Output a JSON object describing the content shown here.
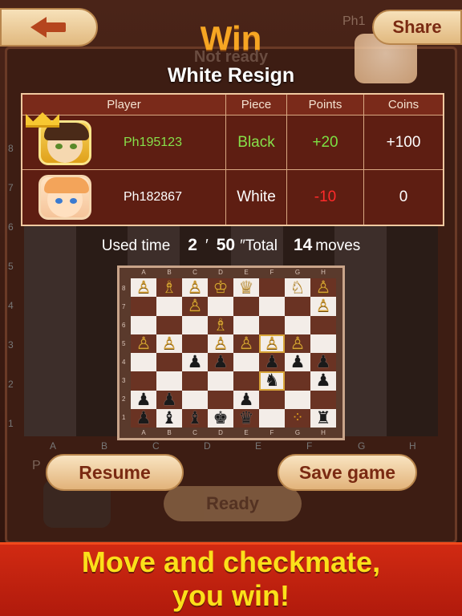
{
  "header": {
    "result_title": "Win",
    "status_text": "Not ready",
    "result_reason": "White Resign",
    "share_label": "Share",
    "opponent_label": "Ph1"
  },
  "result_table": {
    "columns": [
      "Player",
      "Piece",
      "Points",
      "Coins"
    ],
    "rows": [
      {
        "player": "Ph195123",
        "piece": "Black",
        "points": "+20",
        "coins": "+100",
        "winner": true
      },
      {
        "player": "Ph182867",
        "piece": "White",
        "points": "-10",
        "coins": "0",
        "winner": false
      }
    ]
  },
  "game_stats": {
    "used_time_label": "Used time",
    "minutes": "2",
    "minutes_sep": "′",
    "seconds": "50",
    "seconds_sep": "″",
    "total_label": "Total",
    "moves": "14",
    "moves_label": "moves"
  },
  "board": {
    "files": [
      "A",
      "B",
      "C",
      "D",
      "E",
      "F",
      "G",
      "H"
    ],
    "ranks": [
      "8",
      "7",
      "6",
      "5",
      "4",
      "3",
      "2",
      "1"
    ],
    "rows": [
      [
        "wp",
        "wb",
        "wp",
        "wk",
        "wq",
        "",
        "wn",
        "wp"
      ],
      [
        "",
        "",
        "wp",
        "",
        "",
        "",
        "",
        "wp"
      ],
      [
        "",
        "",
        "",
        "wb",
        "",
        "",
        "",
        ""
      ],
      [
        "wp",
        "wp",
        "",
        "wp",
        "wp",
        "wp",
        "wp",
        ""
      ],
      [
        "",
        "",
        "bp",
        "bp",
        "",
        "bp",
        "bp",
        "bp"
      ],
      [
        "",
        "",
        "",
        "",
        "",
        "bn",
        "",
        "bp"
      ],
      [
        "bp",
        "bp",
        "",
        "",
        "bp",
        "",
        "",
        ""
      ],
      [
        "bp",
        "bb",
        "bb",
        "bk",
        "bq",
        "",
        "*",
        "br"
      ]
    ],
    "highlighted": [
      "3-5",
      "5-5"
    ]
  },
  "background_board": {
    "ranks": [
      "8",
      "7",
      "6",
      "5",
      "4",
      "3",
      "2",
      "1"
    ],
    "files": [
      "A",
      "B",
      "C",
      "D",
      "E",
      "F",
      "G",
      "H"
    ]
  },
  "buttons": {
    "resume": "Resume",
    "save_game": "Save game",
    "ready": "Ready"
  },
  "self_label": "P",
  "promo": {
    "line1": "Move and checkmate,",
    "line2": "you win!"
  },
  "colors": {
    "accent_title": "#f6a623",
    "points_positive": "#7be043",
    "points_negative": "#ff2a2a",
    "promo_bg": "#c8220f",
    "promo_text": "#fbe01a"
  }
}
